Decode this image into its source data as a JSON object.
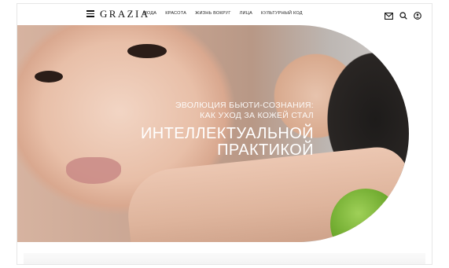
{
  "header": {
    "logo": "GRAZIA",
    "nav": [
      {
        "label": "МОДА"
      },
      {
        "label": "КРАСОТА"
      },
      {
        "label": "ЖИЗНЬ ВОКРУГ"
      },
      {
        "label": "ЛИЦА"
      },
      {
        "label": "КУЛЬТУРНЫЙ КОД"
      }
    ],
    "icons": [
      "menu-icon",
      "mail-icon",
      "search-icon",
      "user-icon"
    ]
  },
  "hero": {
    "kicker_line1": "ЭВОЛЮЦИЯ БЬЮТИ-СОЗНАНИЯ:",
    "kicker_line2": "КАК УХОД ЗА КОЖЕЙ СТАЛ",
    "headline_line1": "ИНТЕЛЛЕКТУАЛЬНОЙ",
    "headline_line2": "ПРАКТИКОЙ"
  },
  "colors": {
    "text_dark": "#111111",
    "caption_text": "#ffffff",
    "lime": "#6aa62a"
  }
}
